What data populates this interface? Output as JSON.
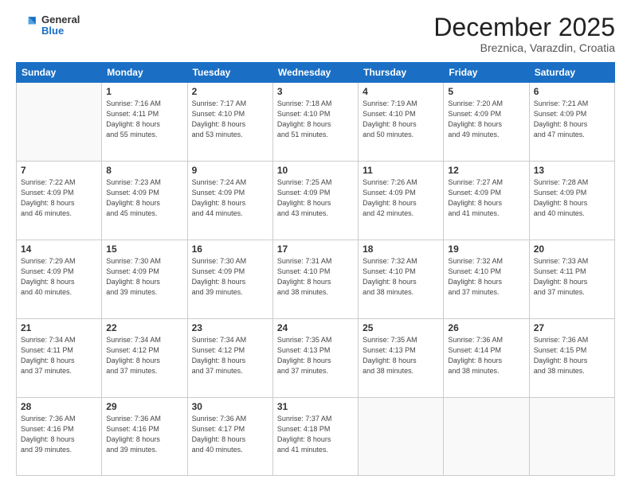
{
  "header": {
    "logo_general": "General",
    "logo_blue": "Blue",
    "month_title": "December 2025",
    "location": "Breznica, Varazdin, Croatia"
  },
  "days_of_week": [
    "Sunday",
    "Monday",
    "Tuesday",
    "Wednesday",
    "Thursday",
    "Friday",
    "Saturday"
  ],
  "weeks": [
    [
      {
        "day": "",
        "info": ""
      },
      {
        "day": "1",
        "info": "Sunrise: 7:16 AM\nSunset: 4:11 PM\nDaylight: 8 hours\nand 55 minutes."
      },
      {
        "day": "2",
        "info": "Sunrise: 7:17 AM\nSunset: 4:10 PM\nDaylight: 8 hours\nand 53 minutes."
      },
      {
        "day": "3",
        "info": "Sunrise: 7:18 AM\nSunset: 4:10 PM\nDaylight: 8 hours\nand 51 minutes."
      },
      {
        "day": "4",
        "info": "Sunrise: 7:19 AM\nSunset: 4:10 PM\nDaylight: 8 hours\nand 50 minutes."
      },
      {
        "day": "5",
        "info": "Sunrise: 7:20 AM\nSunset: 4:09 PM\nDaylight: 8 hours\nand 49 minutes."
      },
      {
        "day": "6",
        "info": "Sunrise: 7:21 AM\nSunset: 4:09 PM\nDaylight: 8 hours\nand 47 minutes."
      }
    ],
    [
      {
        "day": "7",
        "info": "Sunrise: 7:22 AM\nSunset: 4:09 PM\nDaylight: 8 hours\nand 46 minutes."
      },
      {
        "day": "8",
        "info": "Sunrise: 7:23 AM\nSunset: 4:09 PM\nDaylight: 8 hours\nand 45 minutes."
      },
      {
        "day": "9",
        "info": "Sunrise: 7:24 AM\nSunset: 4:09 PM\nDaylight: 8 hours\nand 44 minutes."
      },
      {
        "day": "10",
        "info": "Sunrise: 7:25 AM\nSunset: 4:09 PM\nDaylight: 8 hours\nand 43 minutes."
      },
      {
        "day": "11",
        "info": "Sunrise: 7:26 AM\nSunset: 4:09 PM\nDaylight: 8 hours\nand 42 minutes."
      },
      {
        "day": "12",
        "info": "Sunrise: 7:27 AM\nSunset: 4:09 PM\nDaylight: 8 hours\nand 41 minutes."
      },
      {
        "day": "13",
        "info": "Sunrise: 7:28 AM\nSunset: 4:09 PM\nDaylight: 8 hours\nand 40 minutes."
      }
    ],
    [
      {
        "day": "14",
        "info": "Sunrise: 7:29 AM\nSunset: 4:09 PM\nDaylight: 8 hours\nand 40 minutes."
      },
      {
        "day": "15",
        "info": "Sunrise: 7:30 AM\nSunset: 4:09 PM\nDaylight: 8 hours\nand 39 minutes."
      },
      {
        "day": "16",
        "info": "Sunrise: 7:30 AM\nSunset: 4:09 PM\nDaylight: 8 hours\nand 39 minutes."
      },
      {
        "day": "17",
        "info": "Sunrise: 7:31 AM\nSunset: 4:10 PM\nDaylight: 8 hours\nand 38 minutes."
      },
      {
        "day": "18",
        "info": "Sunrise: 7:32 AM\nSunset: 4:10 PM\nDaylight: 8 hours\nand 38 minutes."
      },
      {
        "day": "19",
        "info": "Sunrise: 7:32 AM\nSunset: 4:10 PM\nDaylight: 8 hours\nand 37 minutes."
      },
      {
        "day": "20",
        "info": "Sunrise: 7:33 AM\nSunset: 4:11 PM\nDaylight: 8 hours\nand 37 minutes."
      }
    ],
    [
      {
        "day": "21",
        "info": "Sunrise: 7:34 AM\nSunset: 4:11 PM\nDaylight: 8 hours\nand 37 minutes."
      },
      {
        "day": "22",
        "info": "Sunrise: 7:34 AM\nSunset: 4:12 PM\nDaylight: 8 hours\nand 37 minutes."
      },
      {
        "day": "23",
        "info": "Sunrise: 7:34 AM\nSunset: 4:12 PM\nDaylight: 8 hours\nand 37 minutes."
      },
      {
        "day": "24",
        "info": "Sunrise: 7:35 AM\nSunset: 4:13 PM\nDaylight: 8 hours\nand 37 minutes."
      },
      {
        "day": "25",
        "info": "Sunrise: 7:35 AM\nSunset: 4:13 PM\nDaylight: 8 hours\nand 38 minutes."
      },
      {
        "day": "26",
        "info": "Sunrise: 7:36 AM\nSunset: 4:14 PM\nDaylight: 8 hours\nand 38 minutes."
      },
      {
        "day": "27",
        "info": "Sunrise: 7:36 AM\nSunset: 4:15 PM\nDaylight: 8 hours\nand 38 minutes."
      }
    ],
    [
      {
        "day": "28",
        "info": "Sunrise: 7:36 AM\nSunset: 4:16 PM\nDaylight: 8 hours\nand 39 minutes."
      },
      {
        "day": "29",
        "info": "Sunrise: 7:36 AM\nSunset: 4:16 PM\nDaylight: 8 hours\nand 39 minutes."
      },
      {
        "day": "30",
        "info": "Sunrise: 7:36 AM\nSunset: 4:17 PM\nDaylight: 8 hours\nand 40 minutes."
      },
      {
        "day": "31",
        "info": "Sunrise: 7:37 AM\nSunset: 4:18 PM\nDaylight: 8 hours\nand 41 minutes."
      },
      {
        "day": "",
        "info": ""
      },
      {
        "day": "",
        "info": ""
      },
      {
        "day": "",
        "info": ""
      }
    ]
  ]
}
